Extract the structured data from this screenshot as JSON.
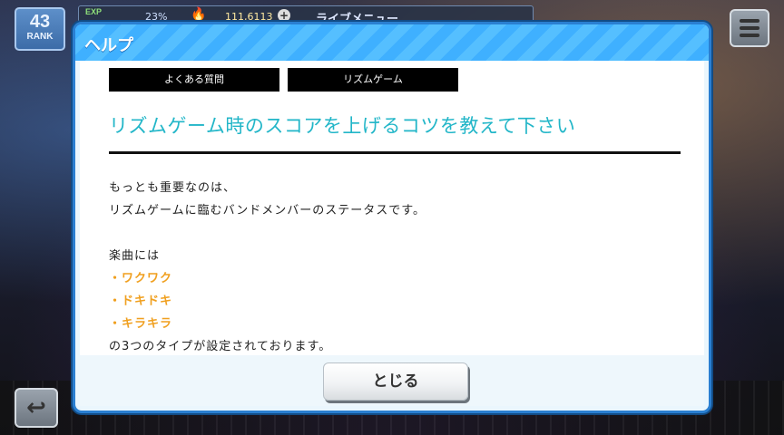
{
  "hud": {
    "rank_number": "43",
    "rank_label": "RANK",
    "exp_label": "EXP",
    "exp_percent": "23%",
    "coins": "111,6113",
    "title": "ライブメニュー"
  },
  "dialog": {
    "title": "ヘルプ",
    "tags": [
      "よくある質問",
      "リズムゲーム"
    ],
    "question": "リズムゲーム時のスコアを上げるコツを教えて下さい",
    "answer_lines": [
      "もっとも重要なのは、",
      "リズムゲームに臨むバンドメンバーのステータスです。",
      "",
      "楽曲には",
      "・ワクワク",
      "・ドキドキ",
      "・キラキラ",
      "の3つのタイプが設定されております。"
    ],
    "highlight_color": "#f0a020",
    "close_label": "とじる"
  },
  "icons": {
    "menu": "hamburger-icon",
    "back": "return-arrow-icon",
    "flame": "flame-icon",
    "plus": "plus-icon"
  }
}
